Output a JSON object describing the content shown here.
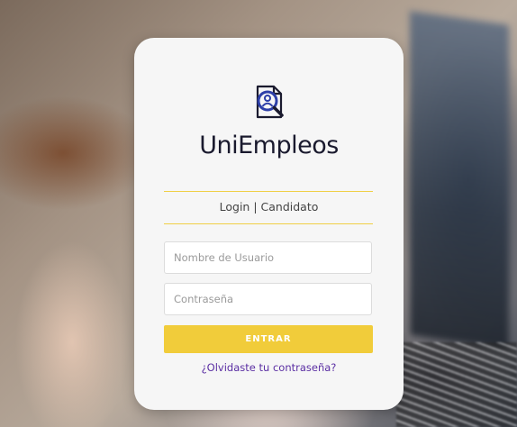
{
  "background": {
    "description_icon": "blurred-laptop-photo"
  },
  "login_card": {
    "logo_icon": "user-search-document-icon",
    "brand_name": "UniEmpleos",
    "subtitle": "Login | Candidato",
    "username_placeholder": "Nombre de Usuario",
    "username_value": "",
    "password_placeholder": "Contraseña",
    "password_value": "",
    "submit_label": "ENTRAR",
    "forgot_link": "¿Olvidaste tu contraseña?"
  },
  "colors": {
    "accent_yellow": "#f1cc3a",
    "link_purple": "#5b2fa3",
    "logo_blue": "#2d3fa8",
    "logo_dark": "#1a1a2e"
  }
}
